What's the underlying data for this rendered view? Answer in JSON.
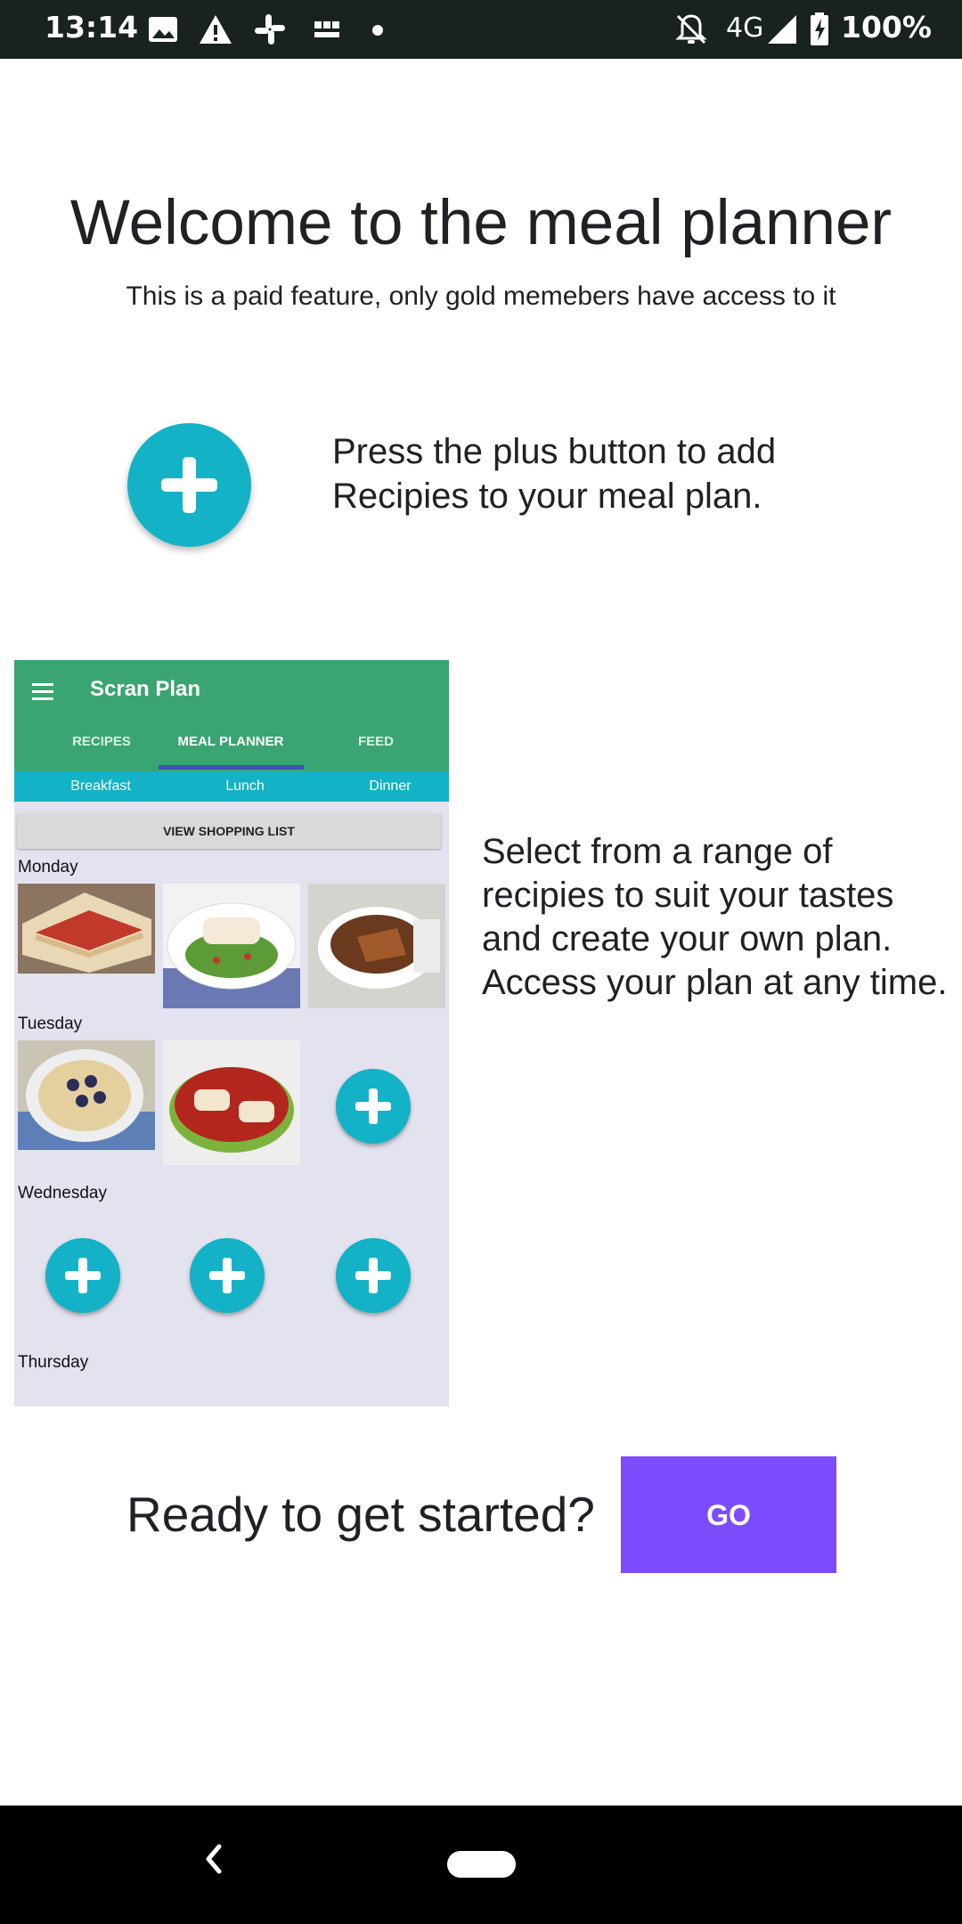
{
  "status_bar": {
    "time": "13:14",
    "network": "4G",
    "battery": "100%",
    "icons": [
      "image-icon",
      "warning-icon",
      "slack-icon",
      "bbc-news-icon",
      "dot-icon",
      "notifications-off-icon",
      "signal-icon",
      "battery-charging-icon"
    ],
    "bbc_news_logo_text": "BBC NEWS"
  },
  "header": {
    "title": "Welcome to the meal planner",
    "subtitle": "This is a paid feature, only gold memebers have access to it"
  },
  "instructions": {
    "plus_instruction": "Press the plus button to add Recipies to your meal plan.",
    "select_instruction_lines": [
      "Select from a range of",
      "recipies to suit your tastes",
      "and create your own plan.",
      "Access your plan at any time."
    ]
  },
  "preview": {
    "app_title": "Scran Plan",
    "tabs": [
      "RECIPES",
      "MEAL PLANNER",
      "FEED"
    ],
    "active_tab": "MEAL PLANNER",
    "meal_tabs": [
      "Breakfast",
      "Lunch",
      "Dinner"
    ],
    "shopping_button": "VIEW SHOPPING LIST",
    "days": [
      "Monday",
      "Tuesday",
      "Wednesday",
      "Thursday"
    ]
  },
  "cta": {
    "prompt": "Ready to get started?",
    "go_label": "GO"
  },
  "colors": {
    "accent_teal": "#13b2c7",
    "app_green": "#3aa572",
    "go_purple": "#7c4dff",
    "status_bar": "#17231c"
  }
}
